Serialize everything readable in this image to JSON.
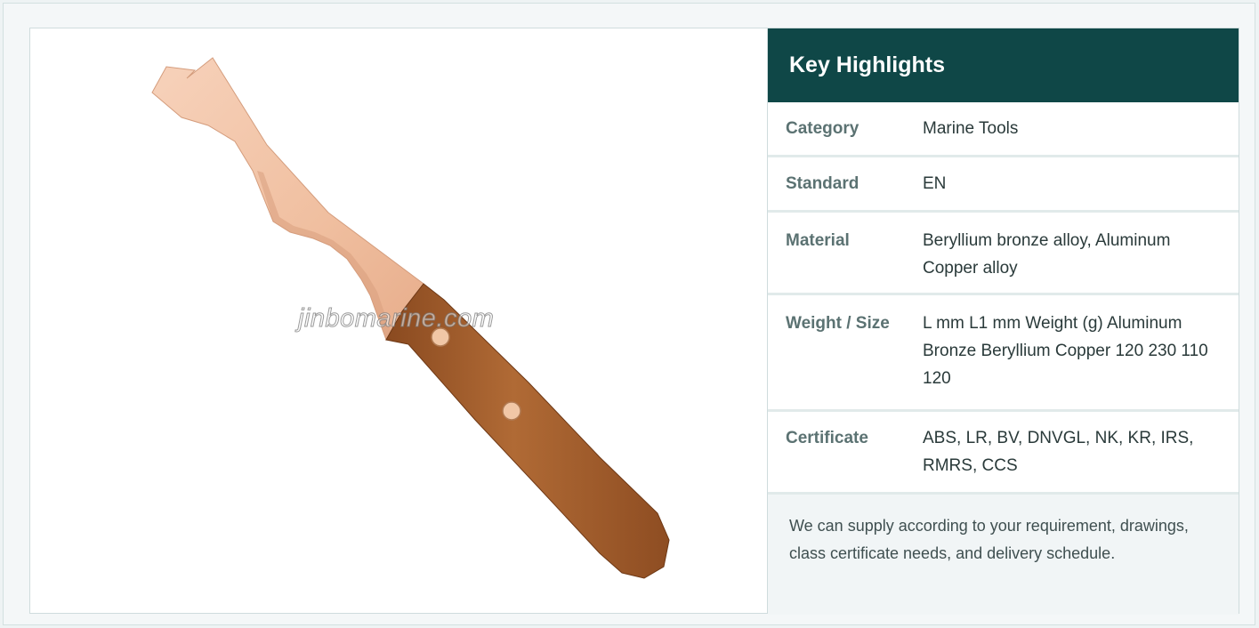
{
  "image": {
    "alt_subject": "wooden handled bronze hook tool",
    "watermark": "jinbomarine.com"
  },
  "highlights": {
    "title": "Key Highlights",
    "rows": [
      {
        "label": "Category",
        "value": "Marine Tools"
      },
      {
        "label": "Standard",
        "value": "EN"
      },
      {
        "label": "Material",
        "value": "Beryllium bronze alloy, Aluminum Copper alloy"
      },
      {
        "label": "Weight / Size",
        "value": "L mm L1 mm Weight (g) Aluminum Bronze Beryllium Copper 120 230 110 120"
      },
      {
        "label": "Certificate",
        "value": "ABS, LR, BV, DNVGL, NK, KR, IRS, RMRS, CCS"
      }
    ],
    "note": "We can supply according to your requirement, drawings, class certificate needs, and delivery schedule."
  },
  "colors": {
    "header_bg": "#0f4747",
    "label_text": "#5b7272",
    "blade": "#f2c2a4",
    "handle": "#a4602e"
  }
}
